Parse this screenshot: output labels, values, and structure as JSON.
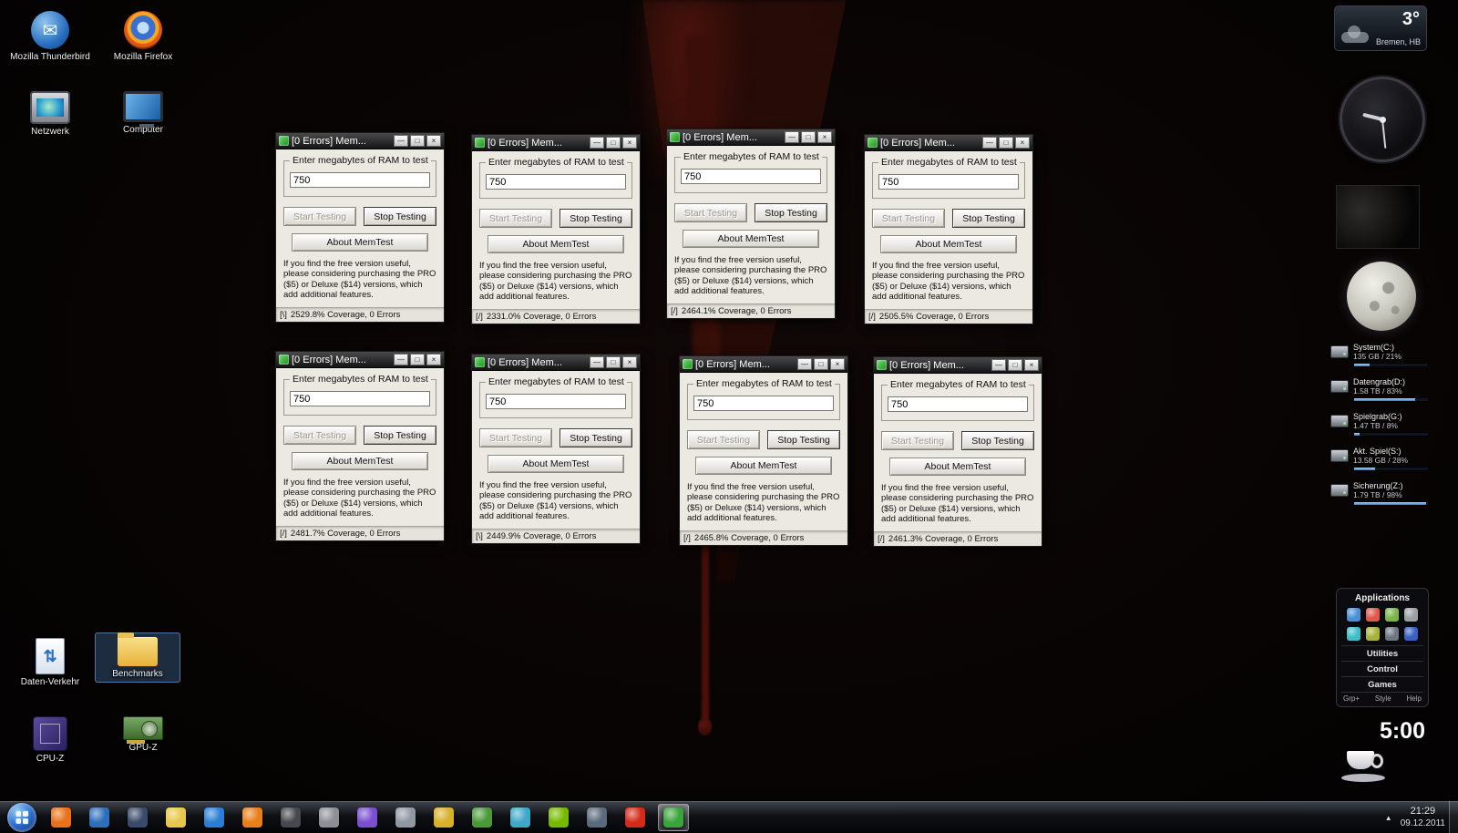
{
  "desktop": {
    "icons": [
      {
        "label": "Mozilla Thunderbird"
      },
      {
        "label": "Mozilla Firefox"
      },
      {
        "label": "Netzwerk"
      },
      {
        "label": "Computer"
      },
      {
        "label": "Daten-Verkehr"
      },
      {
        "label": "Benchmarks",
        "selected": true
      },
      {
        "label": "CPU-Z"
      },
      {
        "label": "GPU-Z"
      }
    ]
  },
  "memtest": {
    "title": "[0 Errors] Mem...",
    "controls": {
      "minimize": "—",
      "maximize": "□",
      "close": "×"
    },
    "group_label": "Enter megabytes of RAM to test",
    "ram_value": "750",
    "start_label": "Start Testing",
    "stop_label": "Stop Testing",
    "about_label": "About MemTest",
    "promo_text": "If you find the free version useful, please considering purchasing the PRO ($5) or Deluxe ($14) versions, which add additional features.",
    "windows": [
      {
        "spinner": "[\\]",
        "status": "2529.8% Coverage, 0 Errors"
      },
      {
        "spinner": "[/]",
        "status": "2331.0% Coverage, 0 Errors"
      },
      {
        "spinner": "[/]",
        "status": "2464.1% Coverage, 0 Errors"
      },
      {
        "spinner": "[/]",
        "status": "2505.5% Coverage, 0 Errors"
      },
      {
        "spinner": "[/]",
        "status": "2481.7% Coverage, 0 Errors"
      },
      {
        "spinner": "[\\]",
        "status": "2449.9% Coverage, 0 Errors"
      },
      {
        "spinner": "[/]",
        "status": "2465.8% Coverage, 0 Errors"
      },
      {
        "spinner": "[/]",
        "status": "2461.3% Coverage, 0 Errors"
      }
    ]
  },
  "gadgets": {
    "weather": {
      "temperature": "3°",
      "location": "Bremen, HB"
    },
    "drives": [
      {
        "name": "System(C:)",
        "info": "135 GB / 21%",
        "percent": 21
      },
      {
        "name": "Datengrab(D:)",
        "info": "1.58 TB / 83%",
        "percent": 83
      },
      {
        "name": "Spielgrab(G:)",
        "info": "1.47 TB / 8%",
        "percent": 8
      },
      {
        "name": "Akt. Spiel(S:)",
        "info": "13.58 GB / 28%",
        "percent": 28
      },
      {
        "name": "Sicherung(Z:)",
        "info": "1.79 TB / 98%",
        "percent": 98
      }
    ],
    "applications": {
      "title": "Applications",
      "sections": [
        "Utilities",
        "Control",
        "Games"
      ],
      "footer": [
        "Grp+",
        "Style",
        "Help"
      ],
      "icons": [
        {
          "name": "app-blue",
          "color": "#4a90d9"
        },
        {
          "name": "app-red",
          "color": "#e2574c"
        },
        {
          "name": "app-green",
          "color": "#7ab648"
        },
        {
          "name": "app-gray",
          "color": "#9aa0a6"
        },
        {
          "name": "app-teal",
          "color": "#3fbdc9"
        },
        {
          "name": "app-olive",
          "color": "#a8b339"
        },
        {
          "name": "app-slate",
          "color": "#6d7783"
        },
        {
          "name": "app-navy",
          "color": "#3a5fc0"
        }
      ]
    },
    "timer": {
      "time": "5:00"
    }
  },
  "taskbar": {
    "tray_expand_icon": "▲",
    "tray_time": "21:29",
    "tray_date": "09.12.2011",
    "icons": [
      {
        "name": "firefox",
        "color": "#e8711a"
      },
      {
        "name": "thunderbird",
        "color": "#2e6fba"
      },
      {
        "name": "messenger",
        "color": "#3a4a6a"
      },
      {
        "name": "explorer",
        "color": "#e8c64a"
      },
      {
        "name": "media-player",
        "color": "#2a7fd4"
      },
      {
        "name": "vlc",
        "color": "#e87f1a"
      },
      {
        "name": "app-dark",
        "color": "#45484e"
      },
      {
        "name": "app-cat",
        "color": "#8b8f96"
      },
      {
        "name": "app-purple",
        "color": "#7a4fd0"
      },
      {
        "name": "settings",
        "color": "#9098a2"
      },
      {
        "name": "app-yellow",
        "color": "#d8b02a"
      },
      {
        "name": "app-green",
        "color": "#4a9a3a"
      },
      {
        "name": "screenshot",
        "color": "#3fa8c9"
      },
      {
        "name": "nvidia",
        "color": "#76b900"
      },
      {
        "name": "remote-desktop",
        "color": "#5a6a7a"
      },
      {
        "name": "opera",
        "color": "#d42a1a"
      },
      {
        "name": "memtest",
        "color": "#3aa53a",
        "active": true
      }
    ]
  }
}
